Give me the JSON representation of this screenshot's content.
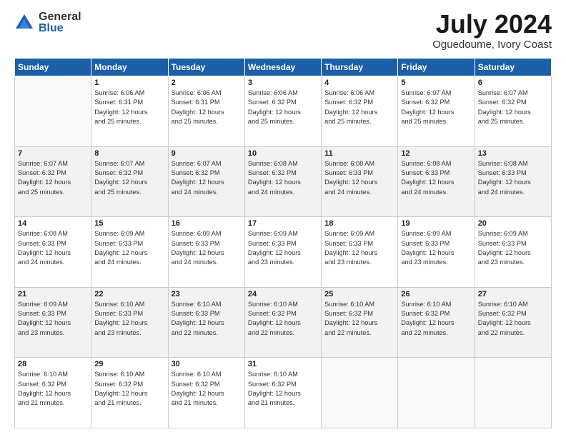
{
  "logo": {
    "general": "General",
    "blue": "Blue"
  },
  "header": {
    "month_year": "July 2024",
    "location": "Oguedoume, Ivory Coast"
  },
  "days_of_week": [
    "Sunday",
    "Monday",
    "Tuesday",
    "Wednesday",
    "Thursday",
    "Friday",
    "Saturday"
  ],
  "weeks": [
    [
      {
        "day": "",
        "text": ""
      },
      {
        "day": "1",
        "text": "Sunrise: 6:06 AM\nSunset: 6:31 PM\nDaylight: 12 hours\nand 25 minutes."
      },
      {
        "day": "2",
        "text": "Sunrise: 6:06 AM\nSunset: 6:31 PM\nDaylight: 12 hours\nand 25 minutes."
      },
      {
        "day": "3",
        "text": "Sunrise: 6:06 AM\nSunset: 6:32 PM\nDaylight: 12 hours\nand 25 minutes."
      },
      {
        "day": "4",
        "text": "Sunrise: 6:06 AM\nSunset: 6:32 PM\nDaylight: 12 hours\nand 25 minutes."
      },
      {
        "day": "5",
        "text": "Sunrise: 6:07 AM\nSunset: 6:32 PM\nDaylight: 12 hours\nand 25 minutes."
      },
      {
        "day": "6",
        "text": "Sunrise: 6:07 AM\nSunset: 6:32 PM\nDaylight: 12 hours\nand 25 minutes."
      }
    ],
    [
      {
        "day": "7",
        "text": "Sunrise: 6:07 AM\nSunset: 6:32 PM\nDaylight: 12 hours\nand 25 minutes."
      },
      {
        "day": "8",
        "text": "Sunrise: 6:07 AM\nSunset: 6:32 PM\nDaylight: 12 hours\nand 25 minutes."
      },
      {
        "day": "9",
        "text": "Sunrise: 6:07 AM\nSunset: 6:32 PM\nDaylight: 12 hours\nand 24 minutes."
      },
      {
        "day": "10",
        "text": "Sunrise: 6:08 AM\nSunset: 6:32 PM\nDaylight: 12 hours\nand 24 minutes."
      },
      {
        "day": "11",
        "text": "Sunrise: 6:08 AM\nSunset: 6:33 PM\nDaylight: 12 hours\nand 24 minutes."
      },
      {
        "day": "12",
        "text": "Sunrise: 6:08 AM\nSunset: 6:33 PM\nDaylight: 12 hours\nand 24 minutes."
      },
      {
        "day": "13",
        "text": "Sunrise: 6:08 AM\nSunset: 6:33 PM\nDaylight: 12 hours\nand 24 minutes."
      }
    ],
    [
      {
        "day": "14",
        "text": "Sunrise: 6:08 AM\nSunset: 6:33 PM\nDaylight: 12 hours\nand 24 minutes."
      },
      {
        "day": "15",
        "text": "Sunrise: 6:09 AM\nSunset: 6:33 PM\nDaylight: 12 hours\nand 24 minutes."
      },
      {
        "day": "16",
        "text": "Sunrise: 6:09 AM\nSunset: 6:33 PM\nDaylight: 12 hours\nand 24 minutes."
      },
      {
        "day": "17",
        "text": "Sunrise: 6:09 AM\nSunset: 6:33 PM\nDaylight: 12 hours\nand 23 minutes."
      },
      {
        "day": "18",
        "text": "Sunrise: 6:09 AM\nSunset: 6:33 PM\nDaylight: 12 hours\nand 23 minutes."
      },
      {
        "day": "19",
        "text": "Sunrise: 6:09 AM\nSunset: 6:33 PM\nDaylight: 12 hours\nand 23 minutes."
      },
      {
        "day": "20",
        "text": "Sunrise: 6:09 AM\nSunset: 6:33 PM\nDaylight: 12 hours\nand 23 minutes."
      }
    ],
    [
      {
        "day": "21",
        "text": "Sunrise: 6:09 AM\nSunset: 6:33 PM\nDaylight: 12 hours\nand 23 minutes."
      },
      {
        "day": "22",
        "text": "Sunrise: 6:10 AM\nSunset: 6:33 PM\nDaylight: 12 hours\nand 23 minutes."
      },
      {
        "day": "23",
        "text": "Sunrise: 6:10 AM\nSunset: 6:33 PM\nDaylight: 12 hours\nand 22 minutes."
      },
      {
        "day": "24",
        "text": "Sunrise: 6:10 AM\nSunset: 6:32 PM\nDaylight: 12 hours\nand 22 minutes."
      },
      {
        "day": "25",
        "text": "Sunrise: 6:10 AM\nSunset: 6:32 PM\nDaylight: 12 hours\nand 22 minutes."
      },
      {
        "day": "26",
        "text": "Sunrise: 6:10 AM\nSunset: 6:32 PM\nDaylight: 12 hours\nand 22 minutes."
      },
      {
        "day": "27",
        "text": "Sunrise: 6:10 AM\nSunset: 6:32 PM\nDaylight: 12 hours\nand 22 minutes."
      }
    ],
    [
      {
        "day": "28",
        "text": "Sunrise: 6:10 AM\nSunset: 6:32 PM\nDaylight: 12 hours\nand 21 minutes."
      },
      {
        "day": "29",
        "text": "Sunrise: 6:10 AM\nSunset: 6:32 PM\nDaylight: 12 hours\nand 21 minutes."
      },
      {
        "day": "30",
        "text": "Sunrise: 6:10 AM\nSunset: 6:32 PM\nDaylight: 12 hours\nand 21 minutes."
      },
      {
        "day": "31",
        "text": "Sunrise: 6:10 AM\nSunset: 6:32 PM\nDaylight: 12 hours\nand 21 minutes."
      },
      {
        "day": "",
        "text": ""
      },
      {
        "day": "",
        "text": ""
      },
      {
        "day": "",
        "text": ""
      }
    ]
  ]
}
